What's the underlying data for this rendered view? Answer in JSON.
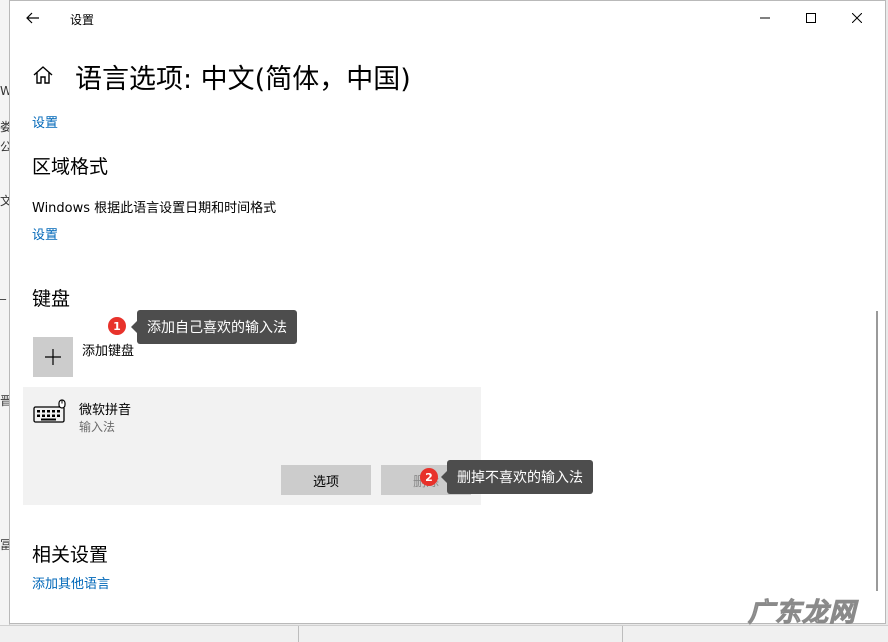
{
  "window": {
    "title": "设置"
  },
  "page": {
    "title": "语言选项: 中文(简体，中国)"
  },
  "top_link": "设置",
  "region": {
    "heading": "区域格式",
    "description": "Windows 根据此语言设置日期和时间格式",
    "link": "设置"
  },
  "keyboard": {
    "heading": "键盘",
    "add_label": "添加键盘",
    "ime": {
      "name": "微软拼音",
      "type": "输入法",
      "options_label": "选项",
      "remove_label": "删除"
    }
  },
  "related": {
    "heading": "相关设置",
    "link": "添加其他语言"
  },
  "annotations": [
    {
      "number": "1",
      "text": "添加自己喜欢的输入法"
    },
    {
      "number": "2",
      "text": "删掉不喜欢的输入法"
    }
  ],
  "background_fragments": [
    "W",
    "娄",
    "公",
    "文",
    "_",
    "晋",
    "冨"
  ],
  "watermark": "广东龙网",
  "colors": {
    "link": "#0067b8",
    "callout_bg": "#4d4d4d",
    "marker": "#e8322b",
    "tile": "#cccccc"
  }
}
